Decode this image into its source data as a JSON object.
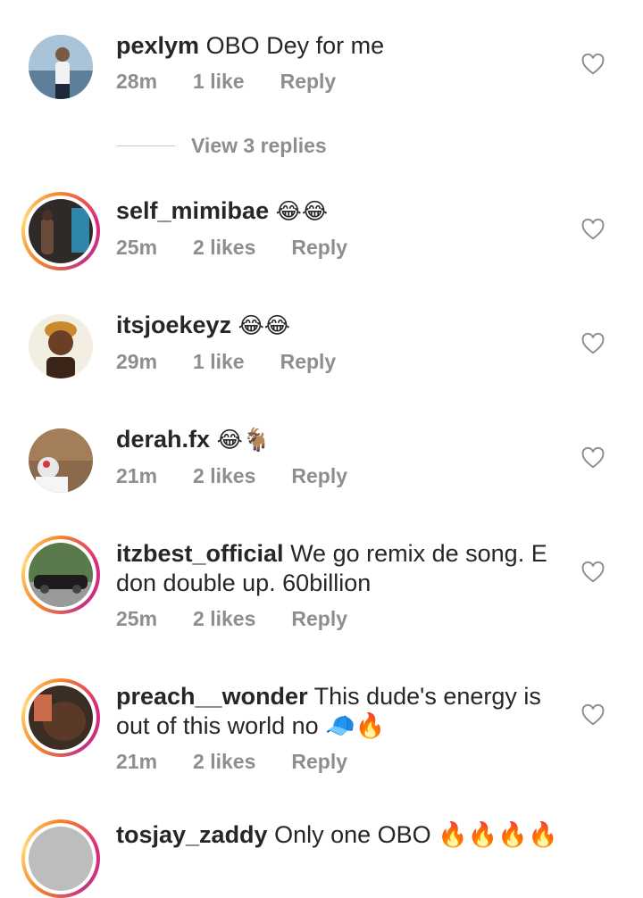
{
  "comments": [
    {
      "username": "pexlym",
      "text": "OBO Dey for me",
      "time": "28m",
      "likes": "1 like",
      "reply": "Reply"
    },
    {
      "username": "self_mimibae",
      "text": "😂😂",
      "time": "25m",
      "likes": "2 likes",
      "reply": "Reply"
    },
    {
      "username": "itsjoekeyz",
      "text": "😂😂",
      "time": "29m",
      "likes": "1 like",
      "reply": "Reply"
    },
    {
      "username": "derah.fx",
      "text": "😂🐐",
      "time": "21m",
      "likes": "2 likes",
      "reply": "Reply"
    },
    {
      "username": "itzbest_official",
      "text": "We go remix de song. E don double up. 60billion",
      "time": "25m",
      "likes": "2 likes",
      "reply": "Reply"
    },
    {
      "username": "preach__wonder",
      "text": "This dude's energy is out of this world no 🧢🔥",
      "time": "21m",
      "likes": "2 likes",
      "reply": "Reply"
    },
    {
      "username": "tosjay_zaddy",
      "text": "Only one OBO 🔥🔥🔥🔥"
    }
  ],
  "view_replies": "View 3 replies",
  "icons": {
    "like": "heart-outline-icon"
  },
  "colors": {
    "meta_text": "#8e8e8e",
    "story_ring_start": "#f58529",
    "story_ring_end": "#dd2a7b"
  }
}
